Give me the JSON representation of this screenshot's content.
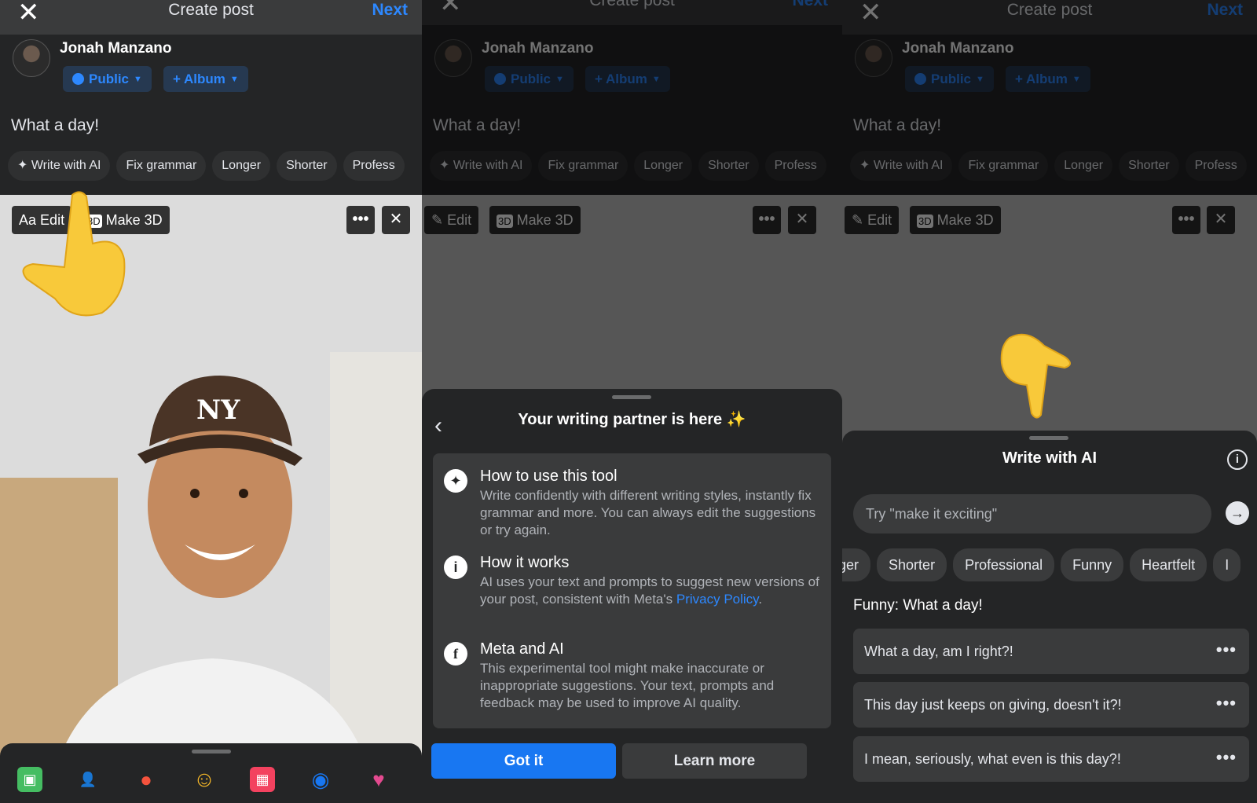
{
  "colors": {
    "accent": "#2d88ff",
    "primary_button": "#1877f2",
    "background": "#242526",
    "surface": "#3a3b3c"
  },
  "composer": {
    "header": {
      "close_icon": "close-icon",
      "title": "Create post",
      "next_label": "Next"
    },
    "user_name": "Jonah Manzano",
    "privacy_label": "Public",
    "album_label": "Album",
    "post_text": "What a day!",
    "ai_pills": [
      "Write with AI",
      "Fix grammar",
      "Longer",
      "Shorter",
      "Profess"
    ],
    "media_overlay": {
      "edit_label": "Edit",
      "make3d_label": "Make 3D",
      "make3d_badge": "3D",
      "text_icon": "Aa"
    }
  },
  "panel1": {
    "tray_icons": [
      "photo-icon",
      "tag-people-icon",
      "location-icon",
      "feeling-icon",
      "event-icon",
      "messenger-icon",
      "heart-icon"
    ]
  },
  "panel2": {
    "sheet_title": "Your writing partner is here ✨",
    "items": [
      {
        "heading": "How to use this tool",
        "desc": "Write confidently with different writing styles, instantly fix grammar and more. You can always edit the suggestions or try again."
      },
      {
        "heading": "How it works",
        "desc": "AI uses your text and prompts to suggest new versions of your post, consistent with Meta's",
        "link": "Privacy Policy",
        "suffix": "."
      },
      {
        "heading": "Meta and AI",
        "desc": "This experimental tool might make inaccurate or inappropriate suggestions. Your text, prompts and feedback may be used to improve AI quality."
      }
    ],
    "primary_button": "Got it",
    "secondary_button": "Learn more"
  },
  "panel3": {
    "sheet_title": "Write with AI",
    "prompt_placeholder": "Try \"make it exciting\"",
    "styles": [
      "nger",
      "Shorter",
      "Professional",
      "Funny",
      "Heartfelt",
      "I"
    ],
    "result_label": "Funny: What a day!",
    "suggestions": [
      "What a day, am I right?!",
      "This day just keeps on giving, doesn't it?!",
      "I mean, seriously, what even is this day?!"
    ],
    "more_glyph": "•••"
  }
}
